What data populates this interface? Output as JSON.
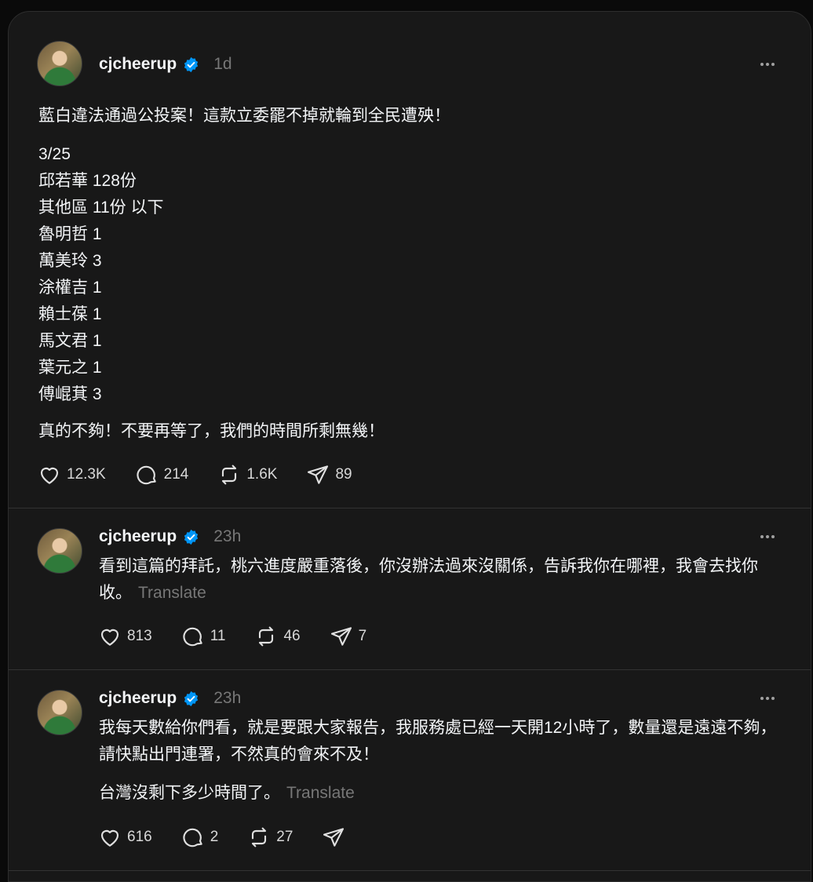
{
  "posts": [
    {
      "username": "cjcheerup",
      "time": "1d",
      "paragraphs": [
        "藍白違法通過公投案！這款立委罷不掉就輪到全民遭殃！",
        "3/25\n邱若華 128份\n其他區 11份 以下\n魯明哲 1\n萬美玲 3\n涂權吉 1\n賴士葆 1\n馬文君 1\n葉元之 1\n傅崐萁 3",
        "真的不夠！不要再等了，我們的時間所剩無幾！"
      ],
      "likes": "12.3K",
      "comments": "214",
      "reposts": "1.6K",
      "shares": "89"
    },
    {
      "username": "cjcheerup",
      "time": "23h",
      "text": "看到這篇的拜託，桃六進度嚴重落後，你沒辦法過來沒關係，告訴我你在哪裡，我會去找你收。",
      "translate": "Translate",
      "likes": "813",
      "comments": "11",
      "reposts": "46",
      "shares": "7"
    },
    {
      "username": "cjcheerup",
      "time": "23h",
      "text": "我每天數給你們看，就是要跟大家報告，我服務處已經一天開12小時了，數量還是遠遠不夠，請快點出門連署，不然真的會來不及！",
      "text2": "台灣沒剩下多少時間了。",
      "translate": "Translate",
      "likes": "616",
      "comments": "2",
      "reposts": "27"
    }
  ],
  "colors": {
    "verified": "#0095f6",
    "background": "#181818",
    "muted": "#777777"
  },
  "icons": [
    "verified-badge-icon",
    "more-icon",
    "heart-icon",
    "comment-icon",
    "repost-icon",
    "share-icon"
  ]
}
